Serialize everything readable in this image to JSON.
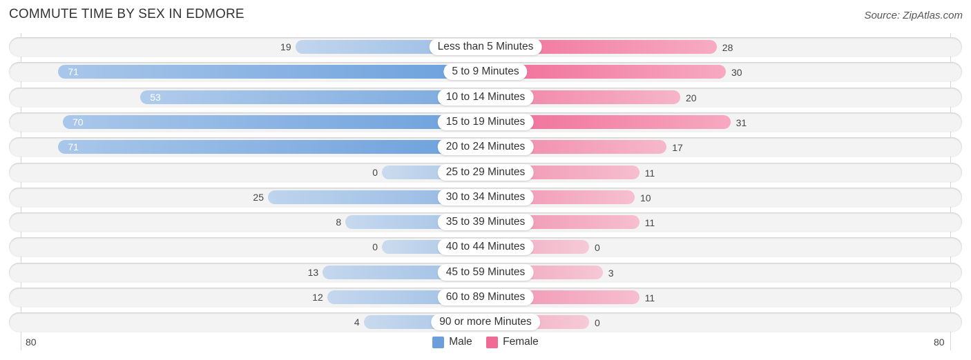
{
  "title": "COMMUTE TIME BY SEX IN EDMORE",
  "source": "Source: ZipAtlas.com",
  "colors": {
    "male": "#6a9fdc",
    "female": "#f06a95"
  },
  "chart_data": {
    "type": "bar",
    "orientation": "horizontal-diverging",
    "title": "COMMUTE TIME BY SEX IN EDMORE",
    "categories": [
      "Less than 5 Minutes",
      "5 to 9 Minutes",
      "10 to 14 Minutes",
      "15 to 19 Minutes",
      "20 to 24 Minutes",
      "25 to 29 Minutes",
      "30 to 34 Minutes",
      "35 to 39 Minutes",
      "40 to 44 Minutes",
      "45 to 59 Minutes",
      "60 to 89 Minutes",
      "90 or more Minutes"
    ],
    "series": [
      {
        "name": "Male",
        "values": [
          19,
          71,
          53,
          70,
          71,
          0,
          25,
          8,
          0,
          13,
          12,
          4
        ]
      },
      {
        "name": "Female",
        "values": [
          28,
          30,
          20,
          31,
          17,
          11,
          10,
          11,
          0,
          3,
          11,
          0
        ]
      }
    ],
    "xlim": [
      -80,
      80
    ],
    "tick_labels": {
      "left": "80",
      "right": "80"
    },
    "legend": {
      "position": "bottom-center",
      "entries": [
        "Male",
        "Female"
      ]
    },
    "grid": false
  }
}
